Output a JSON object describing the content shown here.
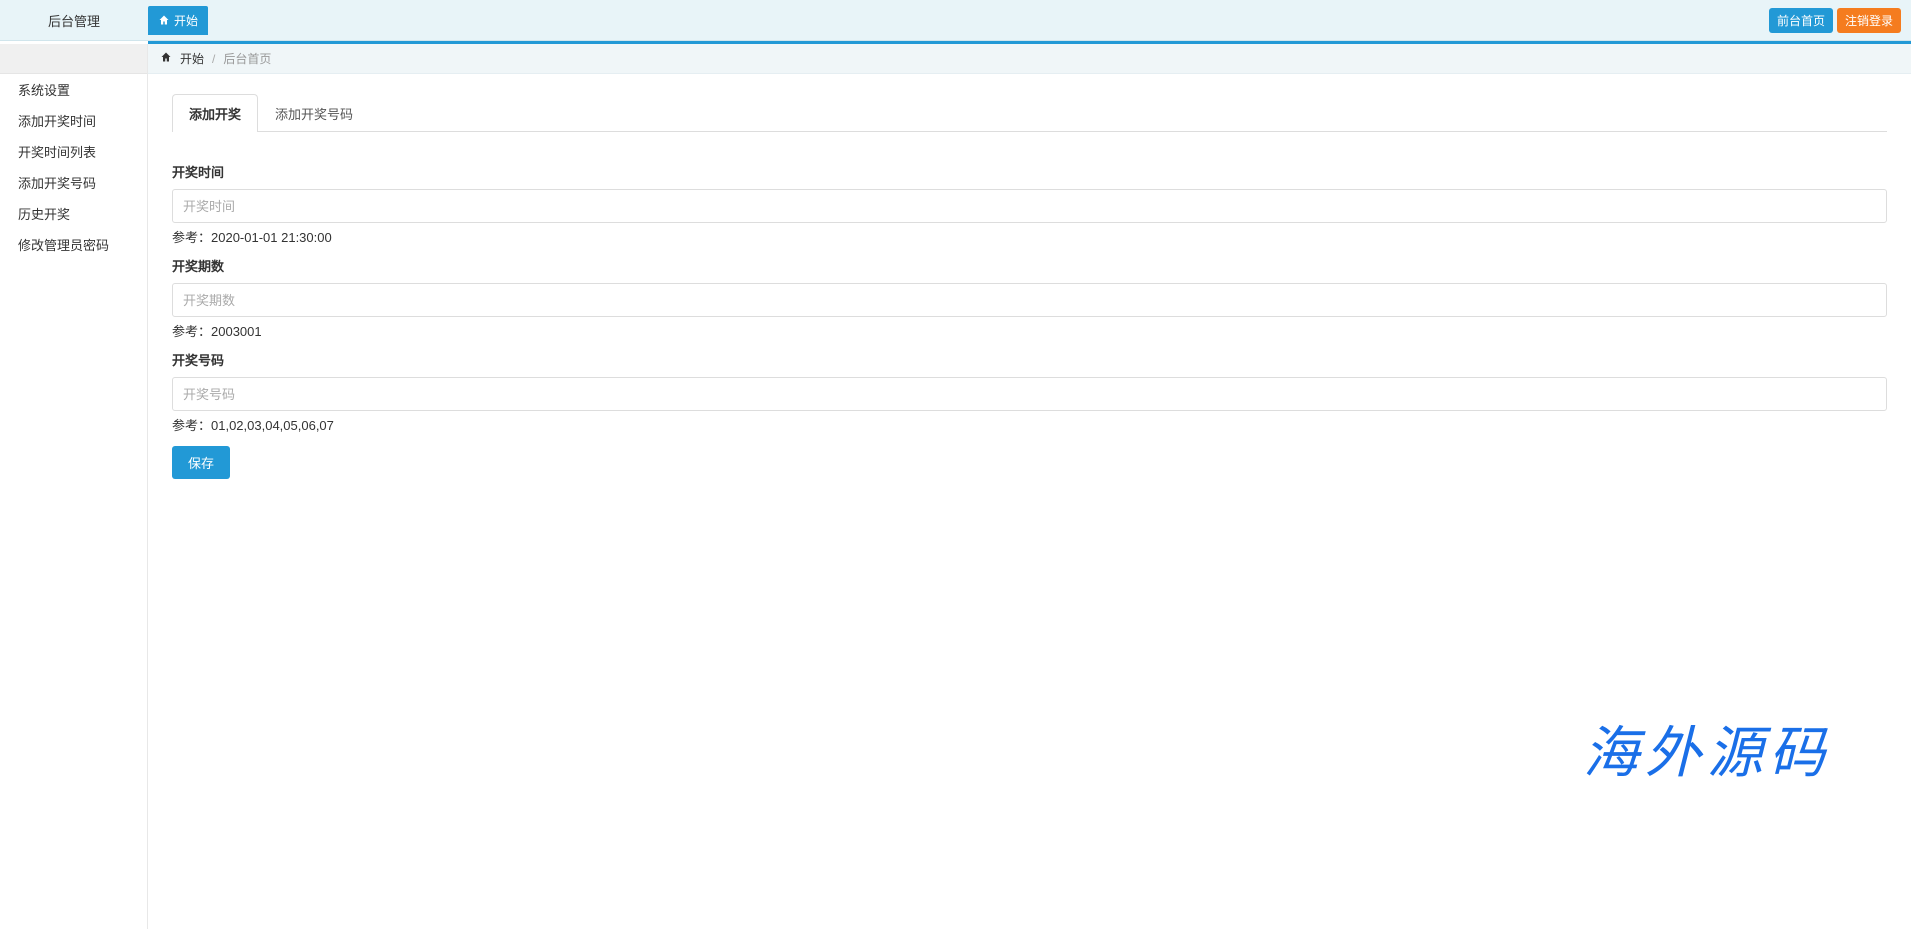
{
  "brand": "后台管理",
  "top_tab": "开始",
  "topbar": {
    "front_label": "前台首页",
    "logout_label": "注销登录"
  },
  "sidebar": {
    "items": [
      "系统设置",
      "添加开奖时间",
      "开奖时间列表",
      "添加开奖号码",
      "历史开奖",
      "修改管理员密码"
    ]
  },
  "breadcrumb": {
    "start": "开始",
    "page": "后台首页"
  },
  "tabs": {
    "add_draw": "添加开奖",
    "add_draw_number": "添加开奖号码"
  },
  "form": {
    "time": {
      "label": "开奖时间",
      "placeholder": "开奖时间",
      "help": "参考：2020-01-01 21:30:00"
    },
    "issue": {
      "label": "开奖期数",
      "placeholder": "开奖期数",
      "help": "参考：2003001"
    },
    "numbers": {
      "label": "开奖号码",
      "placeholder": "开奖号码",
      "help": "参考：01,02,03,04,05,06,07"
    },
    "save_label": "保存"
  },
  "watermark": "海外源码"
}
